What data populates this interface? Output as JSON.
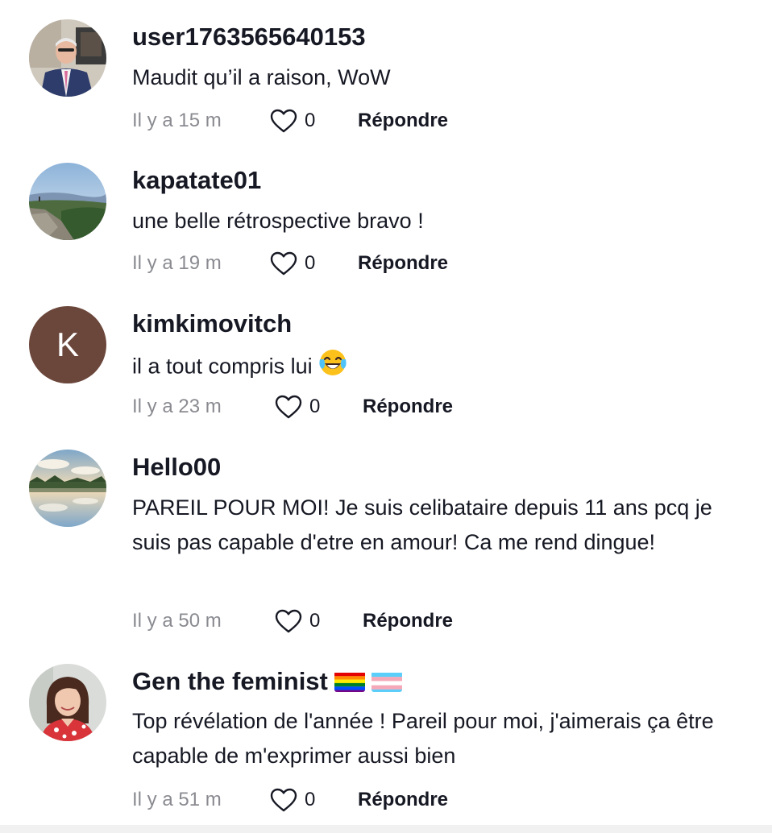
{
  "comments": [
    {
      "username": "user1763565640153",
      "text": "Maudit qu’il a raison, WoW",
      "time": "Il y a 15 m",
      "likes": "0",
      "reply_label": "Répondre"
    },
    {
      "username": "kapatate01",
      "text": "une belle rétrospective bravo !",
      "time": "Il y a 19 m",
      "likes": "0",
      "reply_label": "Répondre"
    },
    {
      "username": "kimkimovitch",
      "text": "il a tout compris lui",
      "avatar_letter": "K",
      "time": "Il y a 23 m",
      "likes": "0",
      "reply_label": "Répondre"
    },
    {
      "username": "Hello00",
      "text": "PAREIL POUR MOI! Je suis celibataire depuis 11 ans pcq je suis pas capable d'etre en amour! Ca me rend dingue!",
      "time": "Il y a 50 m",
      "likes": "0",
      "reply_label": "Répondre"
    },
    {
      "username": "Gen the feminist",
      "text": "Top révélation de l'année ! Pareil pour moi, j'aimerais ça être capable de m'exprimer aussi bien",
      "time": "Il y a 51 m",
      "likes": "0",
      "reply_label": "Répondre"
    }
  ],
  "icons": {
    "like": "heart-outline-icon",
    "emoji": "laughing-tears-emoji",
    "flags": [
      "rainbow-flag",
      "transgender-flag"
    ]
  },
  "colors": {
    "text": "#161823",
    "muted": "#8a8b91",
    "avatar_k": "#6b463b"
  }
}
